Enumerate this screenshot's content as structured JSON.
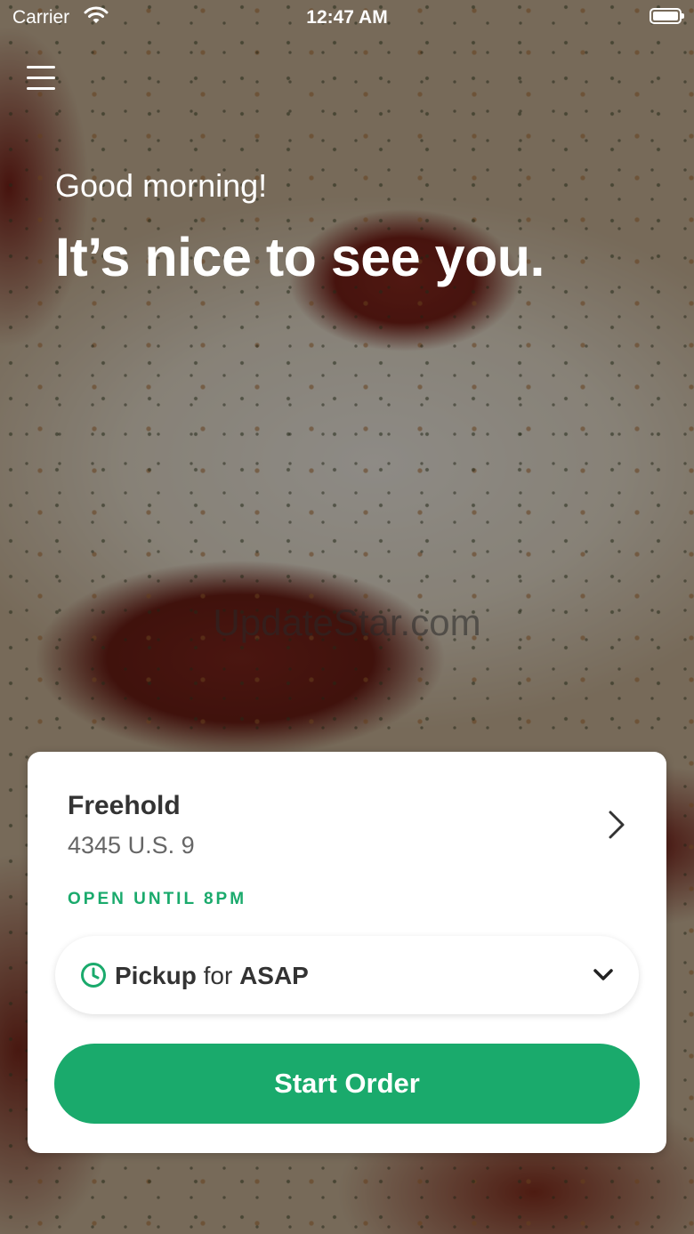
{
  "status_bar": {
    "carrier": "Carrier",
    "time": "12:47 AM",
    "wifi_icon": "wifi-icon",
    "battery_icon": "battery-icon"
  },
  "header": {
    "menu_icon": "hamburger-menu-icon",
    "greeting": "Good morning!",
    "headline": "It’s nice to see you."
  },
  "watermark": "UpdateStar.com",
  "store_card": {
    "name": "Freehold",
    "address": "4345 U.S. 9",
    "status": "OPEN UNTIL 8PM",
    "chevron_icon": "chevron-right-icon",
    "order_mode": {
      "mode": "Pickup",
      "connector": "for",
      "time": "ASAP",
      "clock_icon": "clock-icon",
      "dropdown_icon": "chevron-down-icon"
    },
    "start_button": "Start Order"
  },
  "colors": {
    "accent": "#1aaa6c",
    "card_bg": "#ffffff",
    "overlay": "rgba(0,0,0,0.42)"
  }
}
